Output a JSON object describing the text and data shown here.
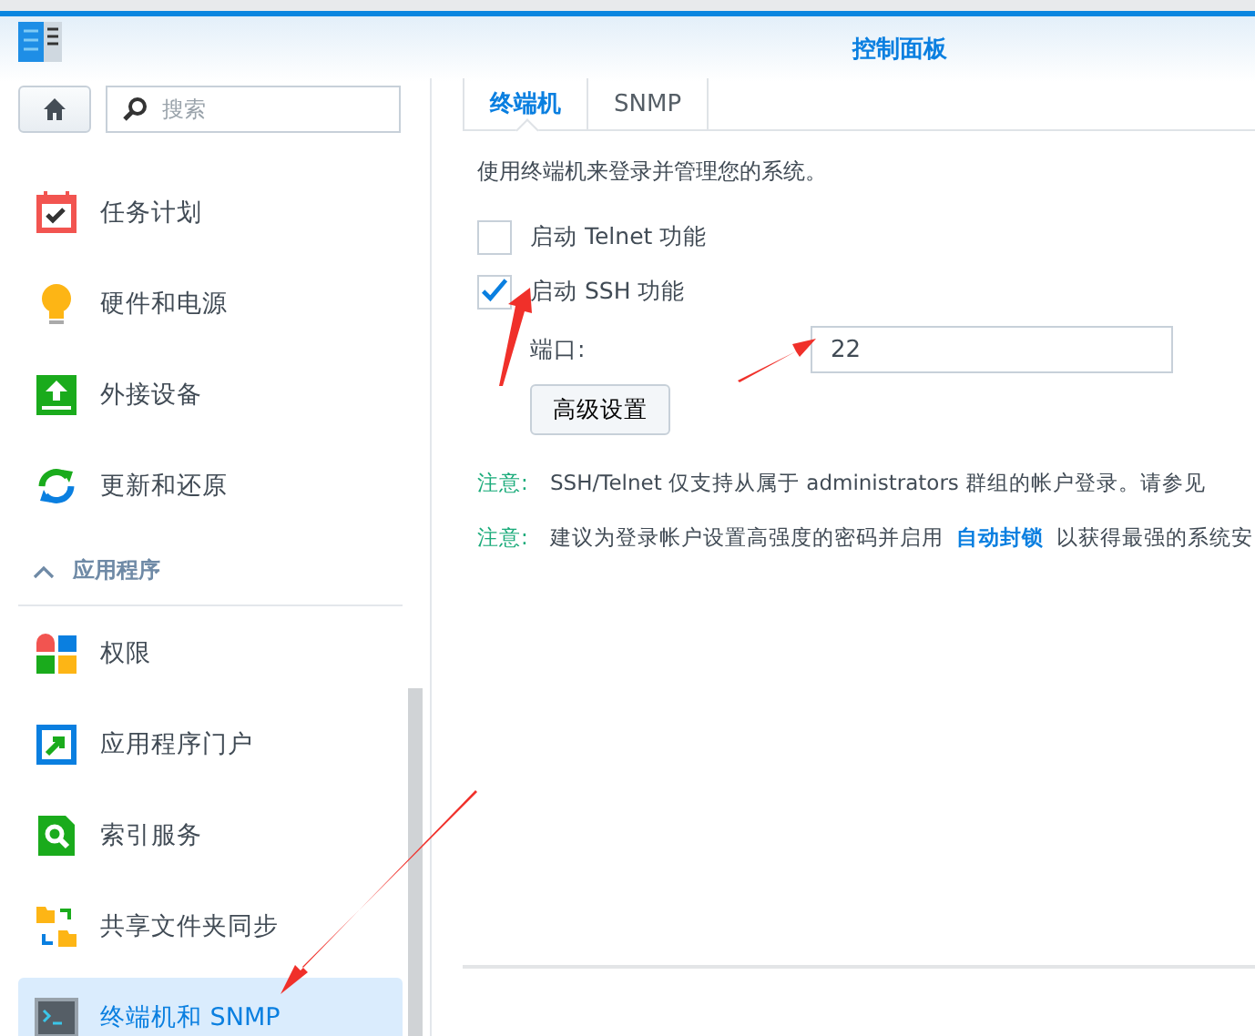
{
  "window": {
    "title": "控制面板"
  },
  "sidebar": {
    "search": {
      "placeholder": "搜索"
    },
    "items": [
      {
        "kind": "item",
        "label": "任务计划",
        "selected": false
      },
      {
        "kind": "item",
        "label": "硬件和电源",
        "selected": false
      },
      {
        "kind": "item",
        "label": "外接设备",
        "selected": false
      },
      {
        "kind": "item",
        "label": "更新和还原",
        "selected": false
      },
      {
        "kind": "section",
        "label": "应用程序",
        "expanded": true,
        "children": [
          {
            "kind": "item",
            "label": "权限",
            "selected": false
          },
          {
            "kind": "item",
            "label": "应用程序门户",
            "selected": false
          },
          {
            "kind": "item",
            "label": "索引服务",
            "selected": false
          },
          {
            "kind": "item",
            "label": "共享文件夹同步",
            "selected": false
          },
          {
            "kind": "item",
            "label": "终端机和 SNMP",
            "selected": true
          }
        ]
      }
    ]
  },
  "tabs": [
    {
      "label": "终端机",
      "selected": true
    },
    {
      "label": "SNMP",
      "selected": false
    }
  ],
  "description": "使用终端机来登录并管理您的系统。",
  "options": [
    {
      "label": "启动 Telnet 功能",
      "checked": false
    },
    {
      "label": "启动 SSH 功能",
      "checked": true
    }
  ],
  "port": {
    "label": "端口:",
    "value": "22"
  },
  "advanced_button": "高级设置",
  "notes": [
    {
      "label": "注意:",
      "before": "SSH/Telnet 仅支持从属于 administrators 群组的帐户登录。请参见"
    },
    {
      "label": "注意:",
      "before": "建议为登录帐户设置高强度的密码并启用",
      "link": "自动封锁",
      "after": "以获得最强的系统安"
    }
  ]
}
